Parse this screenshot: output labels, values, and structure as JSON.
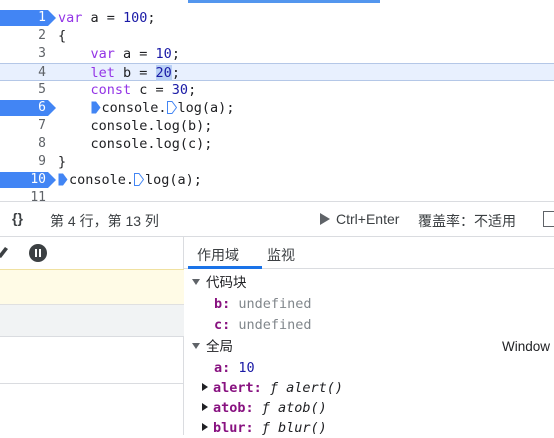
{
  "editor": {
    "lines": [
      {
        "n": "1",
        "breakpoint": true,
        "current": false,
        "parts": [
          [
            "kw",
            "var"
          ],
          [
            "t",
            " a = "
          ],
          [
            "num",
            "100"
          ],
          [
            "t",
            ";"
          ]
        ]
      },
      {
        "n": "2",
        "breakpoint": false,
        "current": false,
        "parts": [
          [
            "t",
            "{"
          ]
        ]
      },
      {
        "n": "3",
        "breakpoint": false,
        "current": false,
        "parts": [
          [
            "t",
            "    "
          ],
          [
            "kw",
            "var"
          ],
          [
            "t",
            " a = "
          ],
          [
            "num",
            "10"
          ],
          [
            "t",
            ";"
          ]
        ]
      },
      {
        "n": "4",
        "breakpoint": false,
        "current": true,
        "parts": [
          [
            "t",
            "    "
          ],
          [
            "kw",
            "let"
          ],
          [
            "t",
            " b = "
          ],
          [
            "numsel",
            "20"
          ],
          [
            "t",
            ";"
          ]
        ]
      },
      {
        "n": "5",
        "breakpoint": false,
        "current": false,
        "parts": [
          [
            "t",
            "    "
          ],
          [
            "kw",
            "const"
          ],
          [
            "t",
            " c = "
          ],
          [
            "num",
            "30"
          ],
          [
            "t",
            ";"
          ]
        ]
      },
      {
        "n": "6",
        "breakpoint": true,
        "current": false,
        "parts": [
          [
            "t",
            "    "
          ],
          [
            "ibp",
            ""
          ],
          [
            "t",
            "console."
          ],
          [
            "ioff",
            ""
          ],
          [
            "t",
            "log(a);"
          ]
        ]
      },
      {
        "n": "7",
        "breakpoint": false,
        "current": false,
        "parts": [
          [
            "t",
            "    console.log(b);"
          ]
        ]
      },
      {
        "n": "8",
        "breakpoint": false,
        "current": false,
        "parts": [
          [
            "t",
            "    console.log(c);"
          ]
        ]
      },
      {
        "n": "9",
        "breakpoint": false,
        "current": false,
        "parts": [
          [
            "t",
            "}"
          ]
        ]
      },
      {
        "n": "10",
        "breakpoint": true,
        "current": false,
        "parts": [
          [
            "ibp",
            ""
          ],
          [
            "t",
            "console."
          ],
          [
            "ioff",
            ""
          ],
          [
            "t",
            "log(a);"
          ]
        ]
      },
      {
        "n": "11",
        "breakpoint": false,
        "current": false,
        "parts": []
      }
    ]
  },
  "status": {
    "braces": "{}",
    "position": "第 4 行，第 13 列",
    "run": "Ctrl+Enter",
    "coverage": "覆盖率：不适用"
  },
  "tabs": {
    "scope": "作用域",
    "watch": "监视"
  },
  "scope": {
    "block_title": "代码块",
    "block_vars": [
      {
        "name": "b",
        "value": "undefined"
      },
      {
        "name": "c",
        "value": "undefined"
      }
    ],
    "global_title": "全局",
    "global_type": "Window",
    "global_vars": [
      {
        "name": "a",
        "value": "10",
        "kind": "num",
        "expandable": false
      },
      {
        "name": "alert",
        "value": "ƒ alert()",
        "kind": "fn",
        "expandable": true
      },
      {
        "name": "atob",
        "value": "ƒ atob()",
        "kind": "fn",
        "expandable": true
      },
      {
        "name": "blur",
        "value": "ƒ blur()",
        "kind": "fn",
        "expandable": true
      }
    ]
  },
  "colors": {
    "breakpoint": "#4285f4",
    "keyword": "#9334e6",
    "number": "#1a1aa6",
    "accent": "#1a73e8",
    "property": "#881280"
  }
}
